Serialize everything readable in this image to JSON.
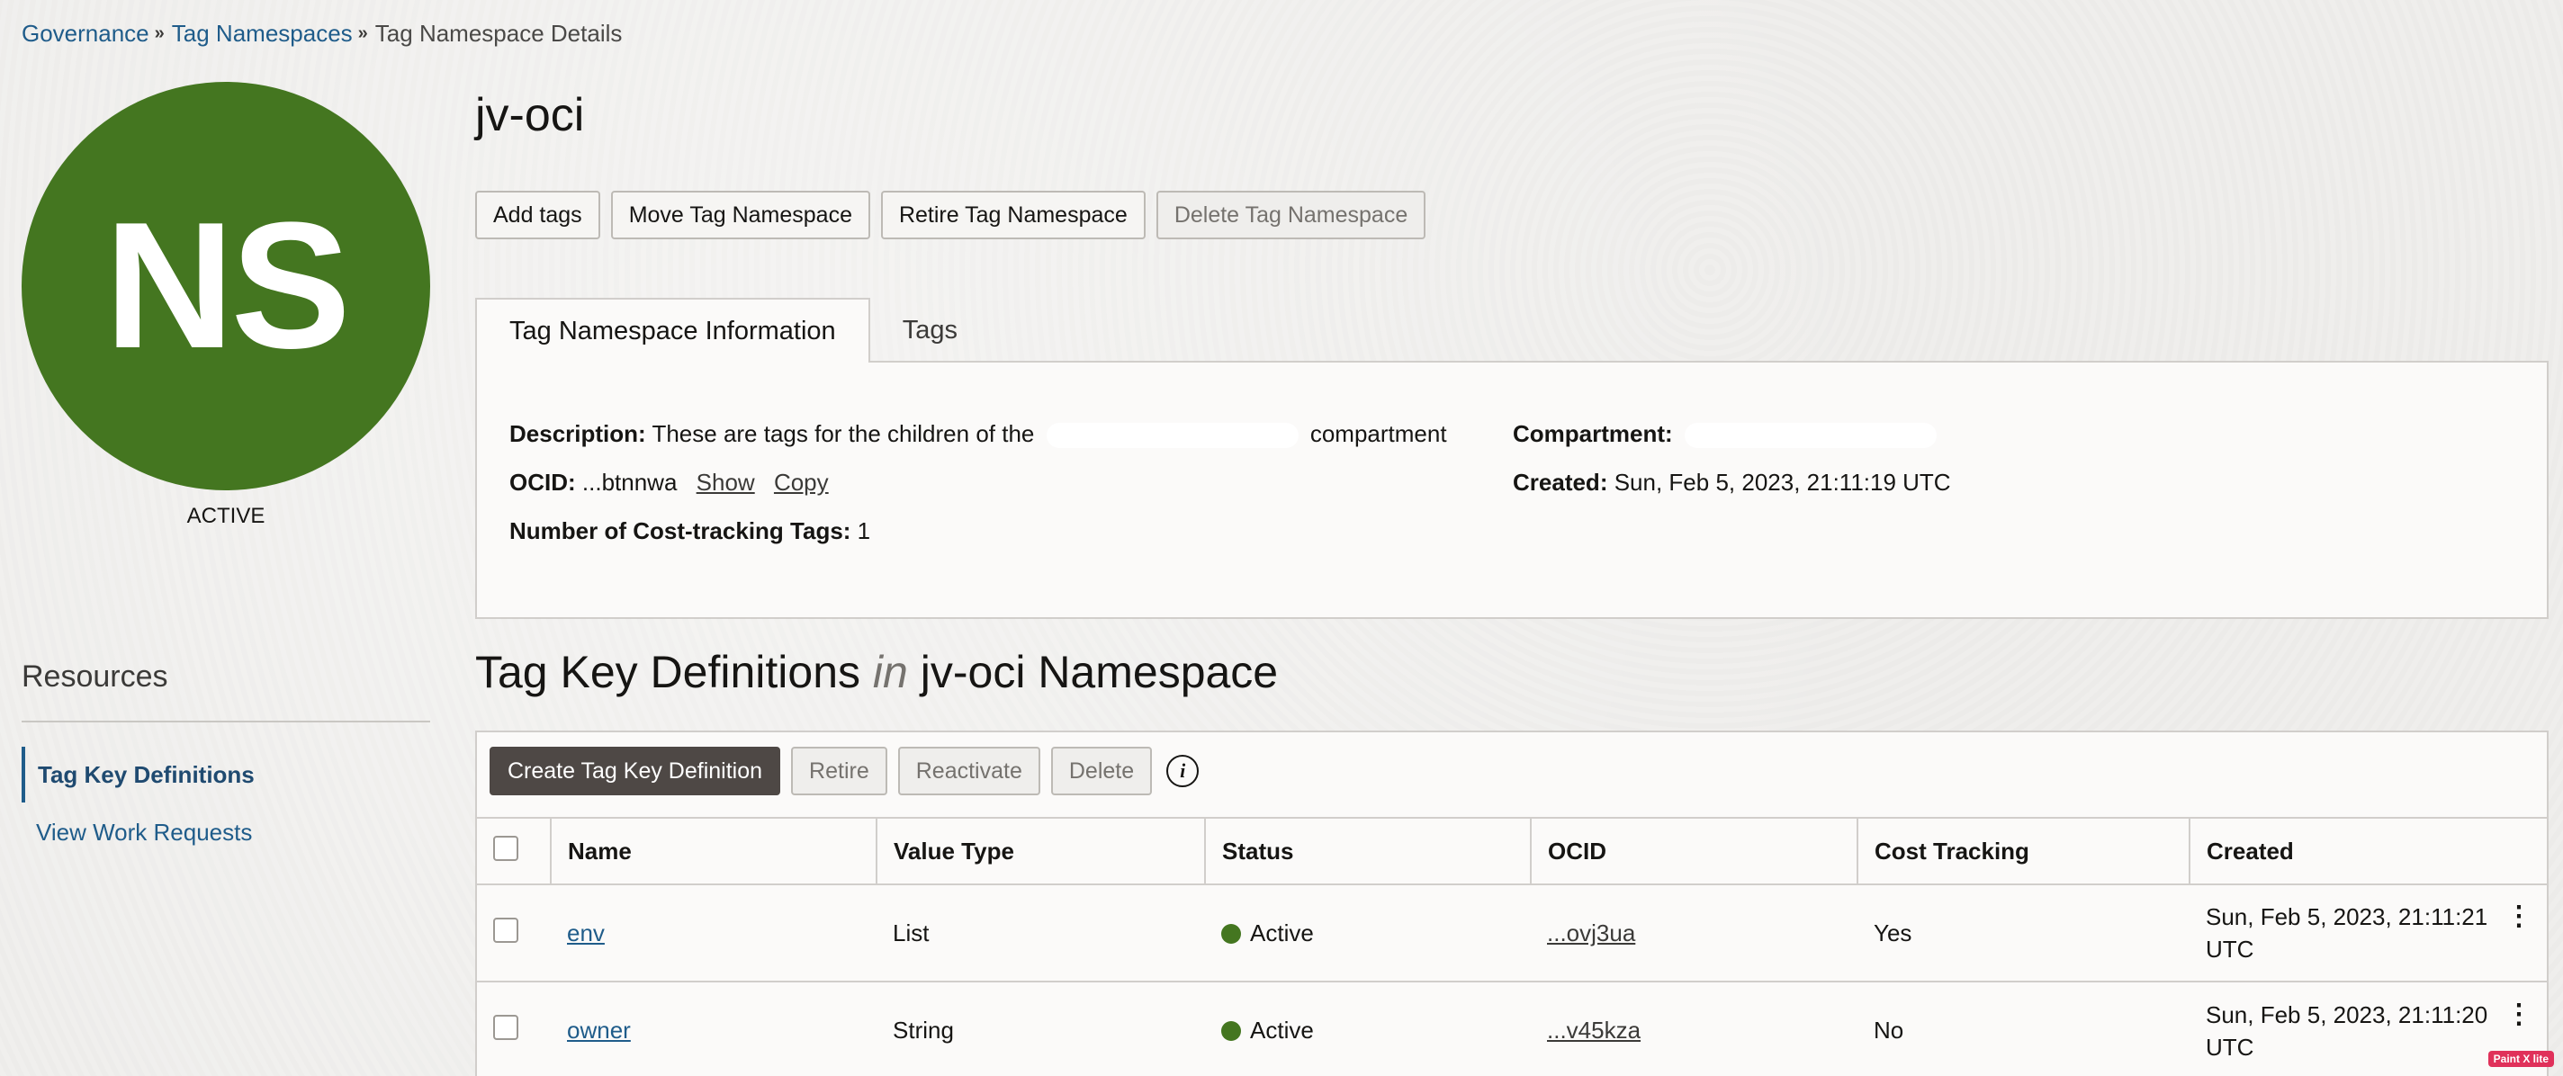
{
  "breadcrumb": {
    "items": [
      "Governance",
      "Tag Namespaces"
    ],
    "current": "Tag Namespace Details"
  },
  "avatar": {
    "initials": "NS",
    "color": "#447620"
  },
  "lifecycle_state": "ACTIVE",
  "page_title": "jv-oci",
  "actions": {
    "add_tags": "Add tags",
    "move": "Move Tag Namespace",
    "retire": "Retire Tag Namespace",
    "delete": "Delete Tag Namespace"
  },
  "tabs": {
    "info": "Tag Namespace Information",
    "tags": "Tags"
  },
  "info": {
    "description_label": "Description:",
    "description_prefix": "These are tags for the children of the",
    "description_suffix": "compartment",
    "ocid_label": "OCID:",
    "ocid_value": "...btnnwa",
    "show_label": "Show",
    "copy_label": "Copy",
    "cost_tracking_label": "Number of Cost-tracking Tags:",
    "cost_tracking_value": "1",
    "compartment_label": "Compartment:",
    "created_label": "Created:",
    "created_value": "Sun, Feb 5, 2023, 21:11:19 UTC"
  },
  "resources": {
    "title": "Resources",
    "items": [
      "Tag Key Definitions",
      "View Work Requests"
    ]
  },
  "section": {
    "title_main": "Tag Key Definitions",
    "title_in": "in",
    "title_ns": "jv-oci Namespace"
  },
  "toolbar": {
    "create": "Create Tag Key Definition",
    "retire": "Retire",
    "reactivate": "Reactivate",
    "delete": "Delete",
    "info_icon": "i"
  },
  "table": {
    "headers": [
      "Name",
      "Value Type",
      "Status",
      "OCID",
      "Cost Tracking",
      "Created"
    ],
    "rows": [
      {
        "name": "env",
        "value_type": "List",
        "status": "Active",
        "ocid": "...ovj3ua",
        "cost_tracking": "Yes",
        "created": "Sun, Feb 5, 2023, 21:11:21 UTC"
      },
      {
        "name": "owner",
        "value_type": "String",
        "status": "Active",
        "ocid": "...v45kza",
        "cost_tracking": "No",
        "created": "Sun, Feb 5, 2023, 21:11:20 UTC"
      }
    ]
  },
  "watermark": "Paint X lite"
}
